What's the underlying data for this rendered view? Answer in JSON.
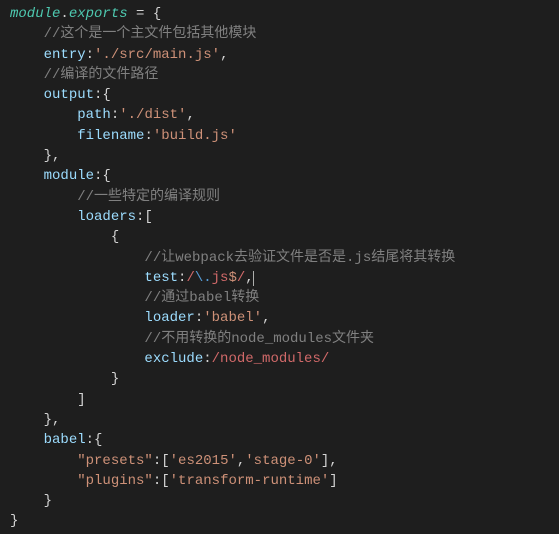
{
  "code": {
    "l1a": "module",
    "l1b": ".",
    "l1c": "exports",
    "l1d": " = {",
    "c1": "//这个是一个主文件包括其他模块",
    "entry_k": "entry",
    "entry_v": "'./src/main.js'",
    "c2": "//编译的文件路径",
    "output_k": "output",
    "path_k": "path",
    "path_v": "'./dist'",
    "filename_k": "filename",
    "filename_v": "'build.js'",
    "module_k": "module",
    "c3": "//一些特定的编译规则",
    "loaders_k": "loaders",
    "c4": "//让webpack去验证文件是否是.js结尾将其转换",
    "test_k": "test",
    "test_re1": "/",
    "test_re2": "\\.",
    "test_re3": "js",
    "test_re4": "$",
    "test_re5": "/",
    "c5": "//通过babel转换",
    "loader_k": "loader",
    "loader_v": "'babel'",
    "c6": "//不用转换的node_modules文件夹",
    "exclude_k": "exclude",
    "exclude_v": "/node_modules/",
    "babel_k": "babel",
    "presets_k": "\"presets\"",
    "presets_v1": "'es2015'",
    "presets_v2": "'stage-0'",
    "plugins_k": "\"plugins\"",
    "plugins_v": "'transform-runtime'"
  }
}
